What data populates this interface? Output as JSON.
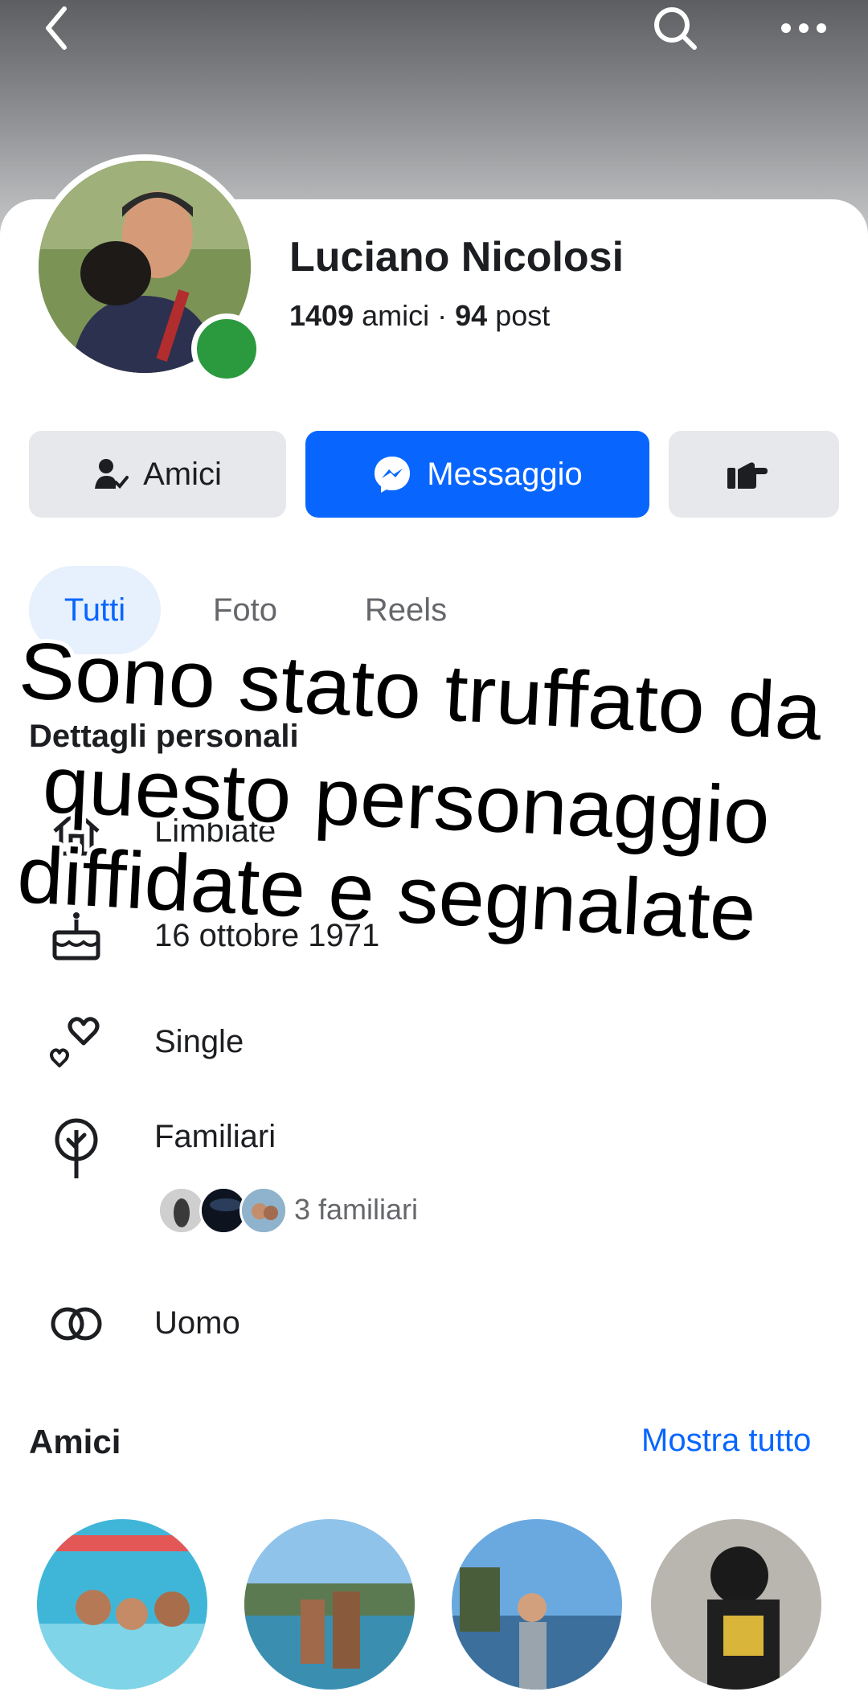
{
  "header": {
    "back_icon": "chevron-left-icon",
    "search_icon": "search-icon",
    "more_icon": "more-horizontal-icon"
  },
  "profile": {
    "name": "Luciano Nicolosi",
    "friends_count": "1409",
    "friends_label": "amici",
    "separator": "·",
    "posts_count": "94",
    "posts_label": "post",
    "online_color": "#2b9a3e"
  },
  "actions": {
    "friends_label": "Amici",
    "message_label": "Messaggio",
    "accent_color": "#0866ff"
  },
  "tabs": [
    {
      "label": "Tutti",
      "active": true
    },
    {
      "label": "Foto",
      "active": false
    },
    {
      "label": "Reels",
      "active": false
    }
  ],
  "details": {
    "title": "Dettagli personali",
    "items": [
      {
        "icon": "home-icon",
        "text": "Limbiate"
      },
      {
        "icon": "birthday-cake-icon",
        "text": "16 ottobre 1971"
      },
      {
        "icon": "hearts-icon",
        "text": "Single"
      },
      {
        "icon": "family-tree-icon",
        "text": "Familiari"
      },
      {
        "icon": "gender-rings-icon",
        "text": "Uomo"
      }
    ],
    "family_count_text": "3 familiari"
  },
  "friends_section": {
    "title": "Amici",
    "show_all": "Mostra tutto"
  },
  "overlay": {
    "line1": "Sono stato truffato da",
    "line2": "questo personaggio",
    "line3": "diffidate e segnalate"
  }
}
